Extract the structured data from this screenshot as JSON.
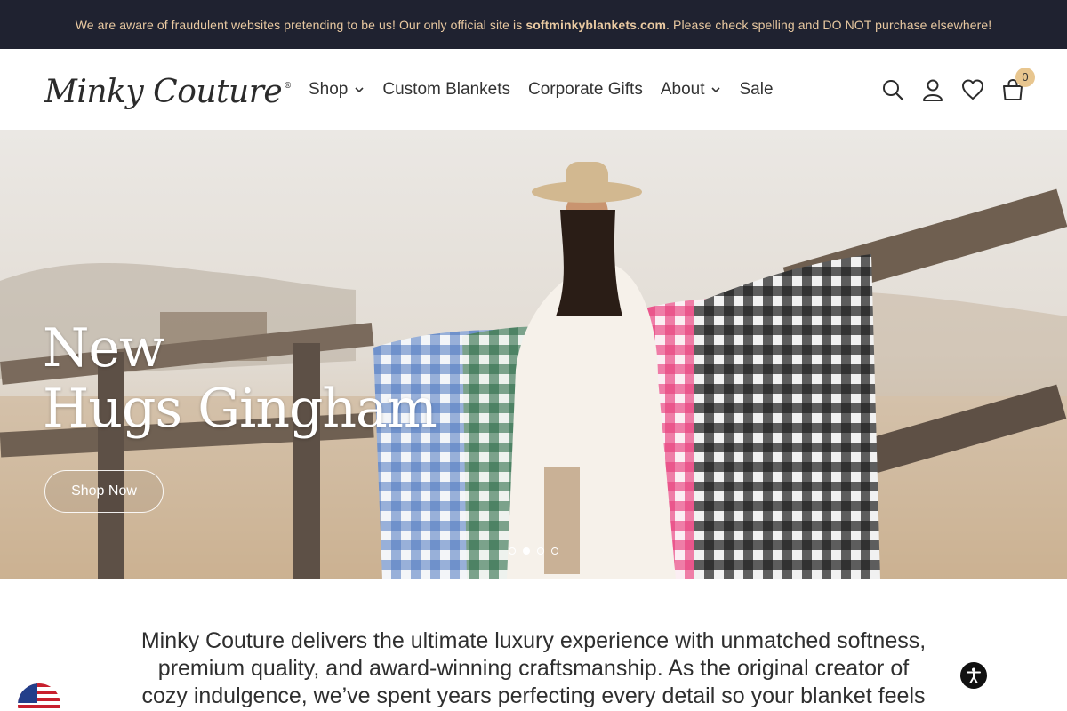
{
  "announcement": {
    "text_before": "We are aware of fraudulent websites pretending to be us! Our only official site is ",
    "domain": "softminkyblankets.com",
    "text_after": ". Please check spelling and DO NOT purchase elsewhere!"
  },
  "logo": {
    "text": "Minky Couture",
    "mark": "®"
  },
  "nav": {
    "shop": "Shop",
    "custom": "Custom Blankets",
    "corporate": "Corporate Gifts",
    "about": "About",
    "sale": "Sale"
  },
  "header_icons": {
    "search": "search-icon",
    "account": "user-icon",
    "wishlist": "heart-icon",
    "cart": "bag-icon",
    "cart_count": "0"
  },
  "hero": {
    "line1": "New",
    "line2": "Hugs Gingham",
    "button": "Shop Now",
    "slides": 4,
    "active_slide": 2
  },
  "intro": {
    "text": "Minky Couture delivers the ultimate luxury experience with unmatched softness, premium quality, and award-winning craftsmanship. As the original creator of cozy indulgence, we’ve spent years perfecting every detail so your blanket feels"
  },
  "colors": {
    "announcement_bg": "#1f2230",
    "announcement_text": "#e9c9a1",
    "badge": "#e8c68f"
  }
}
